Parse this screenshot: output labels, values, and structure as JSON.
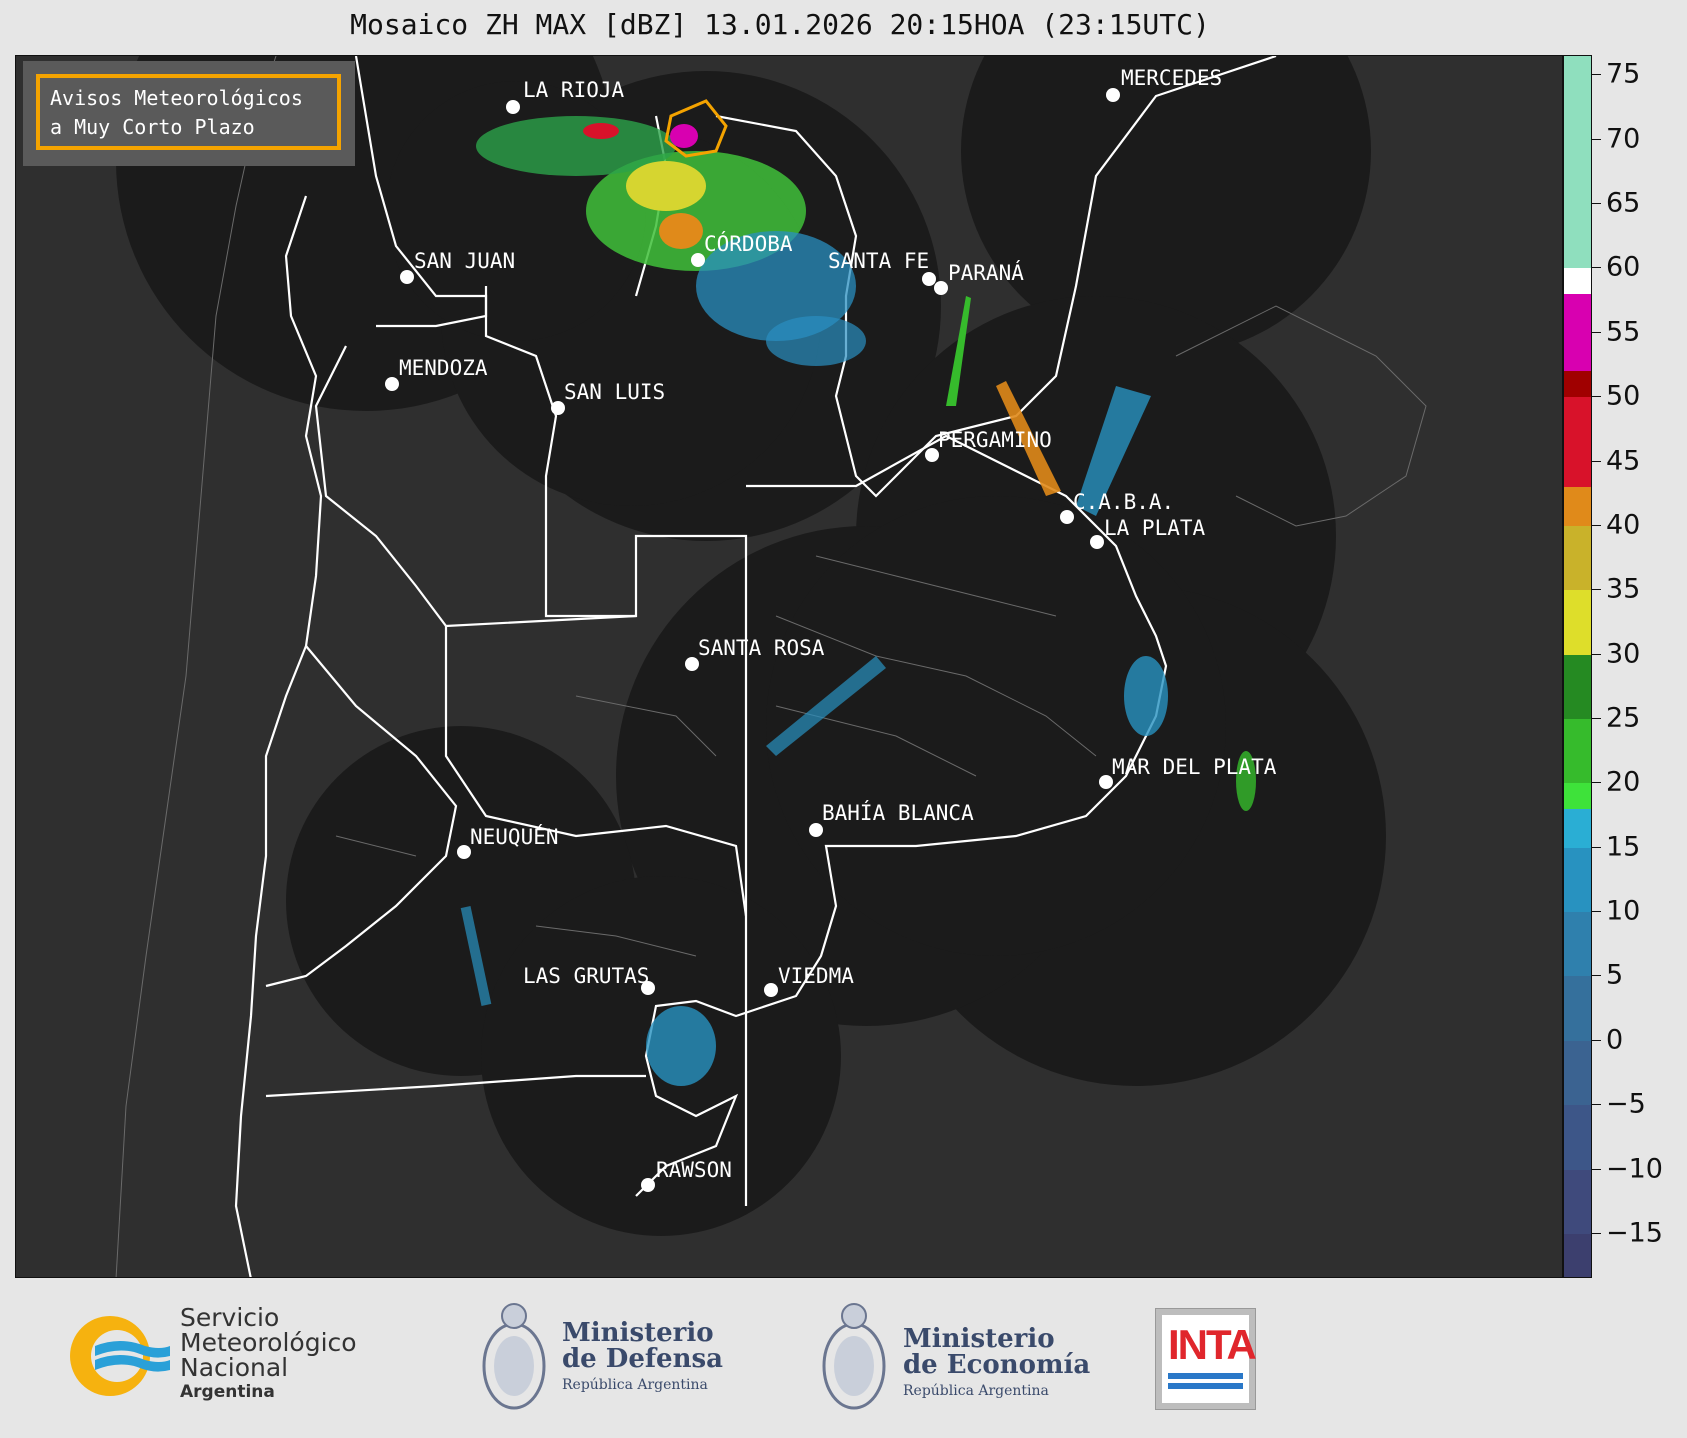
{
  "title": "Mosaico ZH MAX [dBZ] 13.01.2026 20:15HOA (23:15UTC)",
  "legend": {
    "line1": "Avisos Meteorológicos",
    "line2": "a Muy Corto Plazo",
    "border_color": "#f4a300"
  },
  "cities": [
    {
      "name": "LA RIOJA"
    },
    {
      "name": "MERCEDES"
    },
    {
      "name": "CÓRDOBA"
    },
    {
      "name": "SAN JUAN"
    },
    {
      "name": "SANTA FE"
    },
    {
      "name": "PARANÁ"
    },
    {
      "name": "MENDOZA"
    },
    {
      "name": "SAN LUIS"
    },
    {
      "name": "PERGAMINO"
    },
    {
      "name": "C.A.B.A."
    },
    {
      "name": "LA PLATA"
    },
    {
      "name": "SANTA ROSA"
    },
    {
      "name": "MAR DEL PLATA"
    },
    {
      "name": "BAHÍA BLANCA"
    },
    {
      "name": "NEUQUÉN"
    },
    {
      "name": "LAS GRUTAS"
    },
    {
      "name": "VIEDMA"
    },
    {
      "name": "RAWSON"
    }
  ],
  "colorbar": {
    "ticks": [
      "75",
      "70",
      "65",
      "60",
      "55",
      "50",
      "45",
      "40",
      "35",
      "30",
      "25",
      "20",
      "15",
      "10",
      "5",
      "0",
      "−5",
      "−10",
      "−15"
    ],
    "range": [
      -18.5,
      76.5
    ],
    "bands": [
      {
        "from": -18.5,
        "to": -15,
        "color": "#3c3f6e"
      },
      {
        "from": -15,
        "to": -10,
        "color": "#3f4a7c"
      },
      {
        "from": -10,
        "to": -5,
        "color": "#3d5688"
      },
      {
        "from": -5,
        "to": 0,
        "color": "#3b6391"
      },
      {
        "from": 0,
        "to": 5,
        "color": "#35709c"
      },
      {
        "from": 5,
        "to": 10,
        "color": "#2f80ad"
      },
      {
        "from": 10,
        "to": 15,
        "color": "#2892c0"
      },
      {
        "from": 15,
        "to": 18,
        "color": "#2aaed4"
      },
      {
        "from": 18,
        "to": 20,
        "color": "#3ee23a"
      },
      {
        "from": 20,
        "to": 25,
        "color": "#36bb2c"
      },
      {
        "from": 25,
        "to": 30,
        "color": "#258a22"
      },
      {
        "from": 30,
        "to": 35,
        "color": "#dede2a"
      },
      {
        "from": 35,
        "to": 40,
        "color": "#c9b22a"
      },
      {
        "from": 40,
        "to": 43,
        "color": "#e08a1a"
      },
      {
        "from": 43,
        "to": 50,
        "color": "#d8122a"
      },
      {
        "from": 50,
        "to": 52,
        "color": "#a00000"
      },
      {
        "from": 52,
        "to": 58,
        "color": "#d800b0"
      },
      {
        "from": 58,
        "to": 60,
        "color": "#ffffff"
      },
      {
        "from": 60,
        "to": 76.5,
        "color": "#8fdfbe"
      }
    ]
  },
  "footer": {
    "smn": {
      "line1": "Servicio",
      "line2": "Meteorológico",
      "line3": "Nacional",
      "line4": "Argentina"
    },
    "defensa": {
      "line1": "Ministerio",
      "line2": "de Defensa",
      "line3": "República Argentina"
    },
    "economia": {
      "line1": "Ministerio",
      "line2": "de Economía",
      "line3": "República Argentina"
    },
    "inta": {
      "word": "INTA"
    }
  }
}
